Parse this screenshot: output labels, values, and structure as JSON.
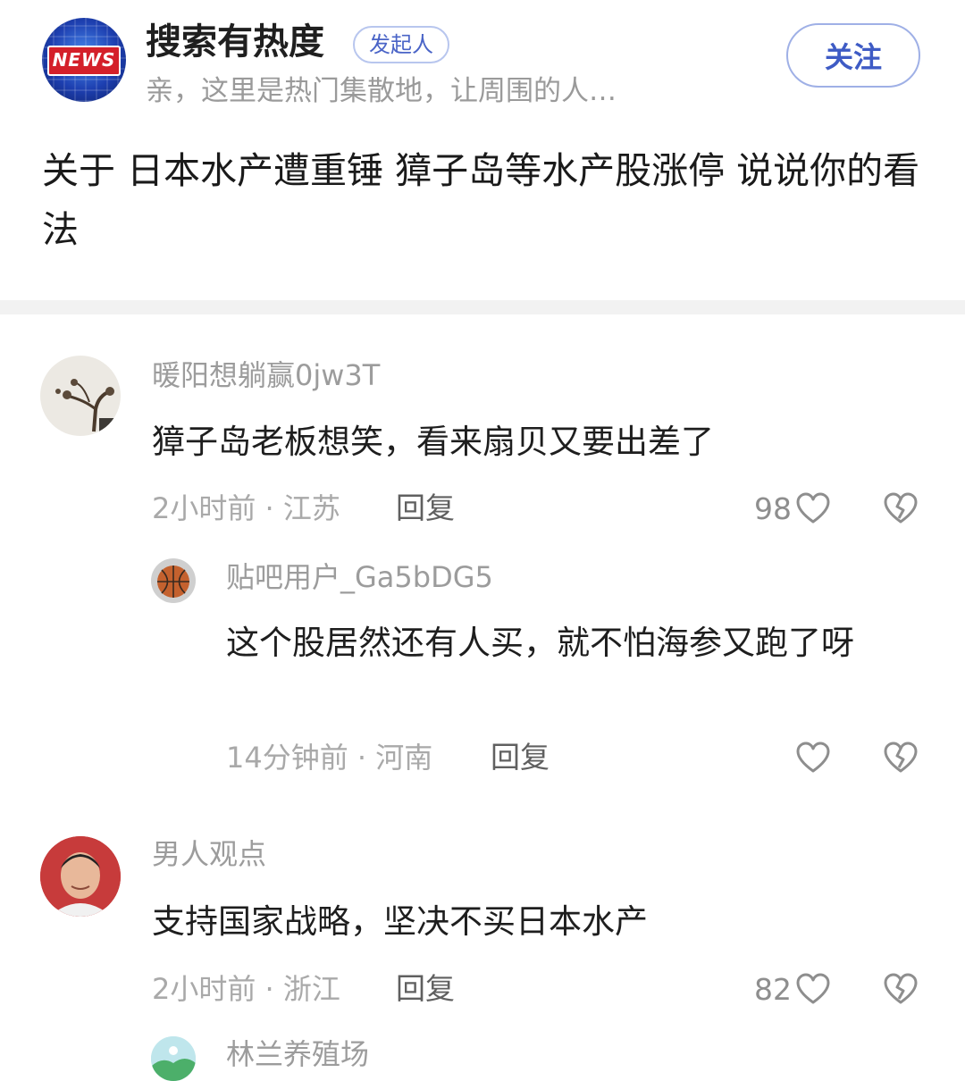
{
  "header": {
    "logo_text": "NEWS",
    "channel_name": "搜索有热度",
    "role_badge": "发起人",
    "description": "亲，这里是热门集散地，让周围的人…",
    "follow_label": "关注"
  },
  "topic": {
    "title": "关于 日本水产遭重锤 獐子岛等水产股涨停 说说你的看法"
  },
  "comments": [
    {
      "username": "暖阳想躺赢0jw3T",
      "text": "獐子岛老板想笑，看来扇贝又要出差了",
      "meta": "2小时前 · 江苏",
      "reply_label": "回复",
      "like_count": "98",
      "replies": [
        {
          "username": "贴吧用户_Ga5bDG5",
          "text": "这个股居然还有人买，就不怕海参又跑了呀",
          "meta": "14分钟前 · 河南",
          "reply_label": "回复",
          "like_count": ""
        }
      ]
    },
    {
      "username": "男人观点",
      "text": "支持国家战略，坚决不买日本水产",
      "meta": "2小时前 · 浙江",
      "reply_label": "回复",
      "like_count": "82"
    },
    {
      "username": "林兰养殖场"
    }
  ],
  "colors": {
    "accent": "#3e5bc5",
    "muted_text": "#9c9c9c",
    "divider": "#f2f2f2"
  },
  "icons": [
    "news-logo",
    "heart-icon",
    "broken-heart-icon"
  ]
}
